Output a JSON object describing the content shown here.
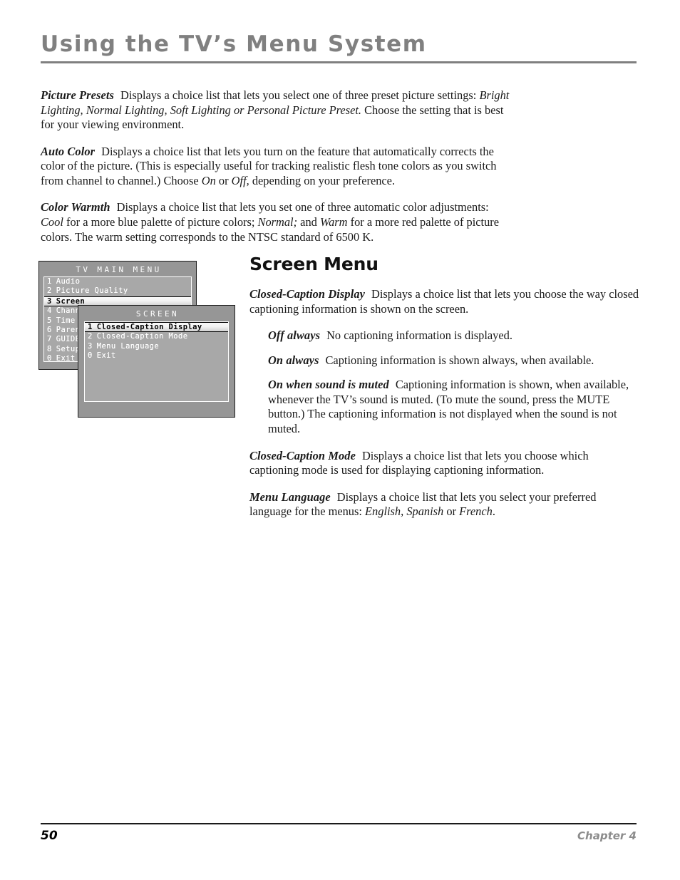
{
  "header": {
    "title": "Using the TV’s Menu System"
  },
  "intro": {
    "paragraphs": [
      {
        "lead": "Picture Presets",
        "body_1": "Displays a choice list that lets you select one of three preset picture settings: ",
        "italic_1": "Bright Lighting, Normal Lighting, Soft Lighting or Personal Picture Preset.",
        "body_2": " Choose the setting that is best for your viewing environment."
      },
      {
        "lead": "Auto Color",
        "body_1": "Displays a choice list that lets you turn on the feature that automatically corrects the color of the picture. (This is especially useful for tracking realistic flesh tone colors as you switch from channel to channel.) Choose ",
        "italic_1": "On",
        "body_2": " or ",
        "italic_2": "Off,",
        "body_3": " depending on your preference."
      },
      {
        "lead": "Color Warmth",
        "body_1": "Displays a choice list that lets you set one of three automatic color adjustments: ",
        "italic_1": "Cool",
        "body_2": " for a more blue palette of picture colors; ",
        "italic_2": "Normal;",
        "body_3": " and ",
        "italic_3": "Warm",
        "body_4": " for a more red palette of picture colors. The warm setting corresponds to the NTSC standard of 6500 K."
      }
    ]
  },
  "tv_menu_graphic": {
    "main_menu": {
      "title": "TV MAIN MENU",
      "items": [
        {
          "num": "1",
          "label": "Audio",
          "selected": false
        },
        {
          "num": "2",
          "label": "Picture Quality",
          "selected": false
        },
        {
          "num": "3",
          "label": "Screen",
          "selected": true
        },
        {
          "num": "4",
          "label": "Channels",
          "selected": false
        },
        {
          "num": "5",
          "label": "Time",
          "selected": false
        },
        {
          "num": "6",
          "label": "Parental Controls",
          "selected": false
        },
        {
          "num": "7",
          "label": "GUIDE Plus+",
          "selected": false
        },
        {
          "num": "8",
          "label": "Setup",
          "selected": false
        },
        {
          "num": "0",
          "label": "Exit",
          "selected": false
        }
      ]
    },
    "screen_menu": {
      "title": "SCREEN",
      "items": [
        {
          "num": "1",
          "label": "Closed-Caption Display",
          "selected": true
        },
        {
          "num": "2",
          "label": "Closed-Caption Mode",
          "selected": false
        },
        {
          "num": "3",
          "label": "Menu Language",
          "selected": false
        },
        {
          "num": "0",
          "label": "Exit",
          "selected": false
        }
      ]
    },
    "colors": {
      "panel_background": "#969696",
      "list_background": "#a8a8a8",
      "panel_border": "#1c1c1c",
      "list_border": "#ffffff",
      "item_text": "#ffffff",
      "selected_text": "#000000",
      "selected_background": "#f2f2f2"
    }
  },
  "right_column": {
    "heading": "Screen Menu",
    "closed_caption_display": {
      "lead": "Closed-Caption Display",
      "body": "Displays a choice list that lets you choose the way closed captioning information is shown on the screen."
    },
    "options": [
      {
        "lead": "Off always",
        "body": "No captioning information is displayed."
      },
      {
        "lead": "On always",
        "body": "Captioning information is shown always, when available."
      },
      {
        "lead": "On when sound is muted",
        "body": "Captioning information is shown, when available, whenever the TV’s sound is muted. (To mute the sound, press the MUTE button.) The captioning information is not displayed when the sound is not muted."
      }
    ],
    "closed_caption_mode": {
      "lead": "Closed-Caption Mode",
      "body": "Displays a choice list that lets you choose which captioning mode is used for displaying captioning information."
    },
    "menu_language": {
      "lead": "Menu Language",
      "body_1": "Displays a choice list that lets you select your preferred language for the menus: ",
      "italic_1": "English, Spanish",
      "body_2": " or ",
      "italic_2": "French",
      "body_3": "."
    }
  },
  "footer": {
    "page_number": "50",
    "chapter": "Chapter 4"
  }
}
